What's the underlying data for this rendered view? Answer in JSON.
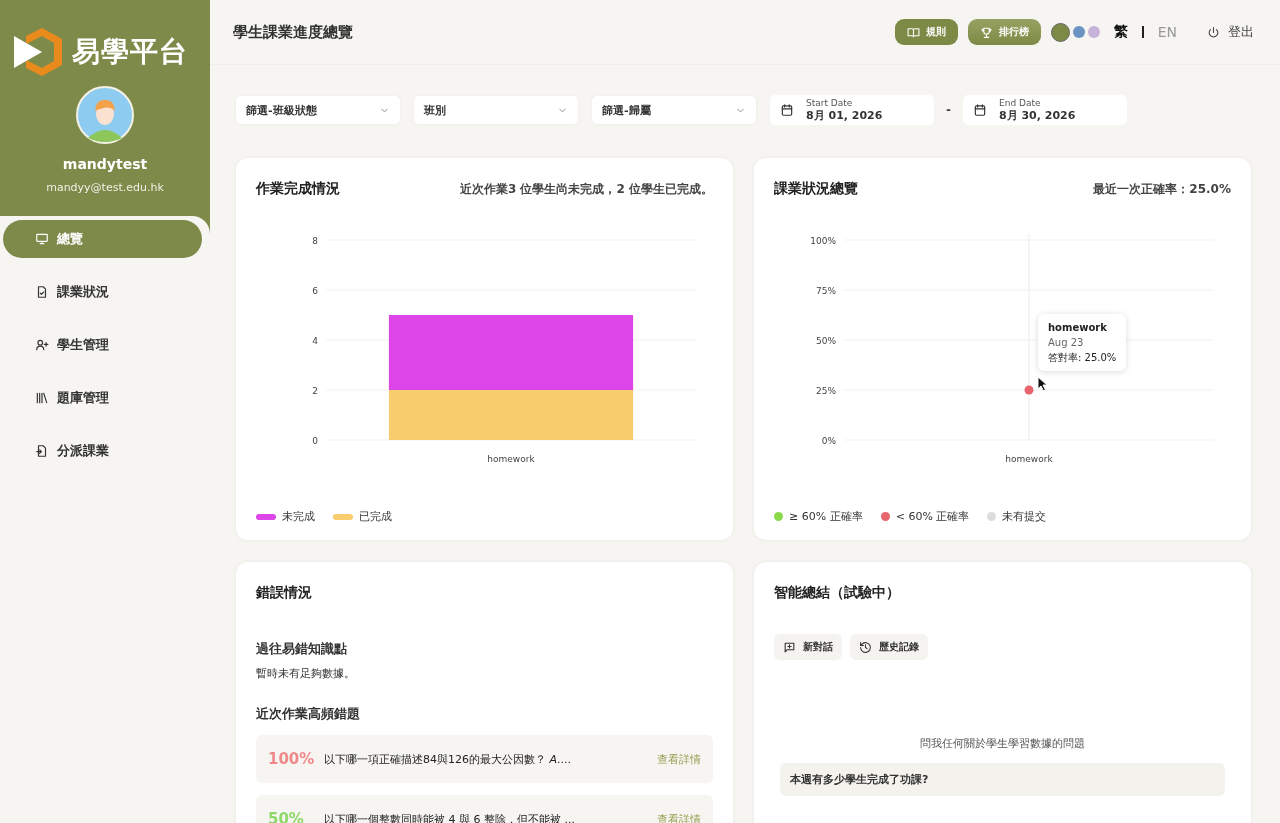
{
  "sidebar": {
    "logo_text": "易學平台",
    "user": {
      "name": "mandytest",
      "email": "mandyy@test.edu.hk"
    },
    "items": [
      {
        "label": "總覽",
        "selected": true
      },
      {
        "label": "課業狀況",
        "selected": false
      },
      {
        "label": "學生管理",
        "selected": false
      },
      {
        "label": "題庫管理",
        "selected": false
      },
      {
        "label": "分派課業",
        "selected": false
      }
    ]
  },
  "header": {
    "title": "學生課業進度總覽",
    "buttons": [
      {
        "label": "規則"
      },
      {
        "label": "排行榜"
      }
    ],
    "theme_colors": [
      {
        "color": "#7d8a45",
        "selected": true
      },
      {
        "color": "#6b93c4",
        "selected": false
      },
      {
        "color": "#c6b3d9",
        "selected": false
      }
    ],
    "languages": [
      {
        "label": "繁",
        "selected": true
      },
      {
        "label": "EN",
        "selected": false
      }
    ],
    "logout": "登出"
  },
  "filters": {
    "selects": [
      {
        "value": "篩選-班級狀態"
      },
      {
        "value": "班別"
      },
      {
        "value": "篩選-歸屬"
      }
    ],
    "start_date": {
      "label": "Start Date",
      "value": "8月 01, 2026"
    },
    "separator": "-",
    "end_date": {
      "label": "End Date",
      "value": "8月 30, 2026"
    }
  },
  "completion_card": {
    "title": "作業完成情況",
    "summary": "近次作業3 位學生尚未完成，2 位學生已完成。",
    "chart_data": {
      "type": "bar",
      "stacked": true,
      "grid": true,
      "categories": [
        "homework"
      ],
      "ylim": [
        0,
        8
      ],
      "yticks": [
        0,
        2,
        4,
        6,
        8
      ],
      "series": [
        {
          "name": "已完成",
          "color": "#f9cd6e",
          "values": [
            2
          ]
        },
        {
          "name": "未完成",
          "color": "#dd45e8",
          "values": [
            3
          ]
        }
      ]
    }
  },
  "status_card": {
    "title": "課業狀況總覽",
    "summary": "最近一次正確率：25.0%",
    "chart_data": {
      "type": "scatter",
      "grid": true,
      "x": [
        "homework"
      ],
      "ref_lines": [
        {
          "axis": "x",
          "value": "homework"
        }
      ],
      "ylim": [
        0,
        100
      ],
      "yticks": [
        {
          "value": 0,
          "label": "0%"
        },
        {
          "value": 25,
          "label": "25%"
        },
        {
          "value": 50,
          "label": "50%"
        },
        {
          "value": 75,
          "label": "75%"
        },
        {
          "value": 100,
          "label": "100%"
        }
      ],
      "series": [
        {
          "color": "#e8646c",
          "values": [
            25
          ]
        }
      ]
    },
    "tooltip": {
      "title": "homework",
      "date": "Aug 23",
      "value": "答對率: 25.0%"
    },
    "legend": [
      {
        "label": "≥ 60% 正確率",
        "color": "#8bd94a"
      },
      {
        "label": "< 60% 正確率",
        "color": "#e8646c"
      },
      {
        "label": "未有提交",
        "color": "#dcdcdc"
      }
    ]
  },
  "mistakes_card": {
    "title": "錯誤情況",
    "past_heading": "過往易錯知識點",
    "past_note": "暫時未有足夠數據。",
    "recent_heading": "近次作業高頻錯題",
    "rows": [
      {
        "percent": "100%",
        "color": "#f08a8a",
        "question": "以下哪一項正確描述84與126的最大公因數？ *A*....",
        "link": "查看詳情"
      },
      {
        "percent": "50%",
        "color": "#8fd86a",
        "question": "以下哪一個整數同時能被 4 與 6 整除，但不能被 ...",
        "link": "查看詳情"
      }
    ]
  },
  "ai_card": {
    "title": "智能總結（試驗中）",
    "buttons": [
      {
        "label": "新對話"
      },
      {
        "label": "歷史記錄"
      }
    ],
    "prompt": "問我任何關於學生學習數據的問題",
    "suggestions": [
      "本週有多少學生完成了功課?"
    ]
  }
}
